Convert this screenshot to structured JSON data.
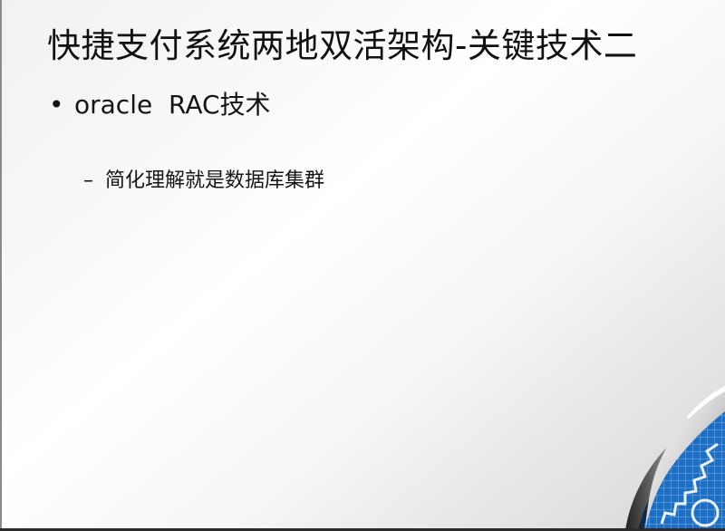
{
  "slide": {
    "title": "快捷支付系统两地双活架构-关键技术二",
    "bullet": {
      "marker": "•",
      "text": "oracle  RAC技术"
    },
    "sub_bullet": {
      "marker": "–",
      "text": "简化理解就是数据库集群"
    }
  },
  "decoration": {
    "corner_icon": "page-curl-gear-icon",
    "curl_color": "#1c6fc6",
    "grid_color": "#7fb0e6"
  }
}
